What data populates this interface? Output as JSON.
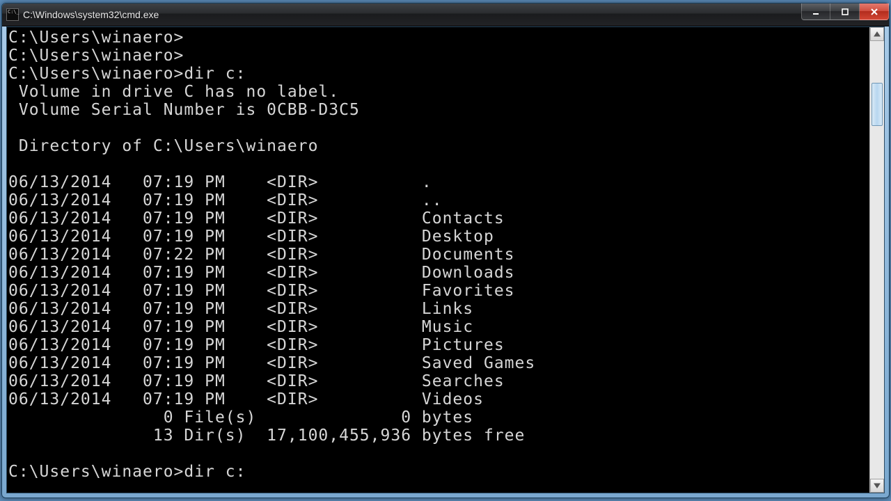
{
  "window": {
    "title": "C:\\Windows\\system32\\cmd.exe"
  },
  "terminal": {
    "prompt": "C:\\Users\\winaero>",
    "command": "dir c:",
    "volume_line": " Volume in drive C has no label.",
    "serial_line": " Volume Serial Number is 0CBB-D3C5",
    "dir_of_line": " Directory of C:\\Users\\winaero",
    "entries": [
      {
        "date": "06/13/2014",
        "time": "07:19 PM",
        "type": "<DIR>",
        "name": "."
      },
      {
        "date": "06/13/2014",
        "time": "07:19 PM",
        "type": "<DIR>",
        "name": ".."
      },
      {
        "date": "06/13/2014",
        "time": "07:19 PM",
        "type": "<DIR>",
        "name": "Contacts"
      },
      {
        "date": "06/13/2014",
        "time": "07:19 PM",
        "type": "<DIR>",
        "name": "Desktop"
      },
      {
        "date": "06/13/2014",
        "time": "07:22 PM",
        "type": "<DIR>",
        "name": "Documents"
      },
      {
        "date": "06/13/2014",
        "time": "07:19 PM",
        "type": "<DIR>",
        "name": "Downloads"
      },
      {
        "date": "06/13/2014",
        "time": "07:19 PM",
        "type": "<DIR>",
        "name": "Favorites"
      },
      {
        "date": "06/13/2014",
        "time": "07:19 PM",
        "type": "<DIR>",
        "name": "Links"
      },
      {
        "date": "06/13/2014",
        "time": "07:19 PM",
        "type": "<DIR>",
        "name": "Music"
      },
      {
        "date": "06/13/2014",
        "time": "07:19 PM",
        "type": "<DIR>",
        "name": "Pictures"
      },
      {
        "date": "06/13/2014",
        "time": "07:19 PM",
        "type": "<DIR>",
        "name": "Saved Games"
      },
      {
        "date": "06/13/2014",
        "time": "07:19 PM",
        "type": "<DIR>",
        "name": "Searches"
      },
      {
        "date": "06/13/2014",
        "time": "07:19 PM",
        "type": "<DIR>",
        "name": "Videos"
      }
    ],
    "summary_files": "               0 File(s)              0 bytes",
    "summary_dirs": "              13 Dir(s)  17,100,455,936 bytes free"
  }
}
